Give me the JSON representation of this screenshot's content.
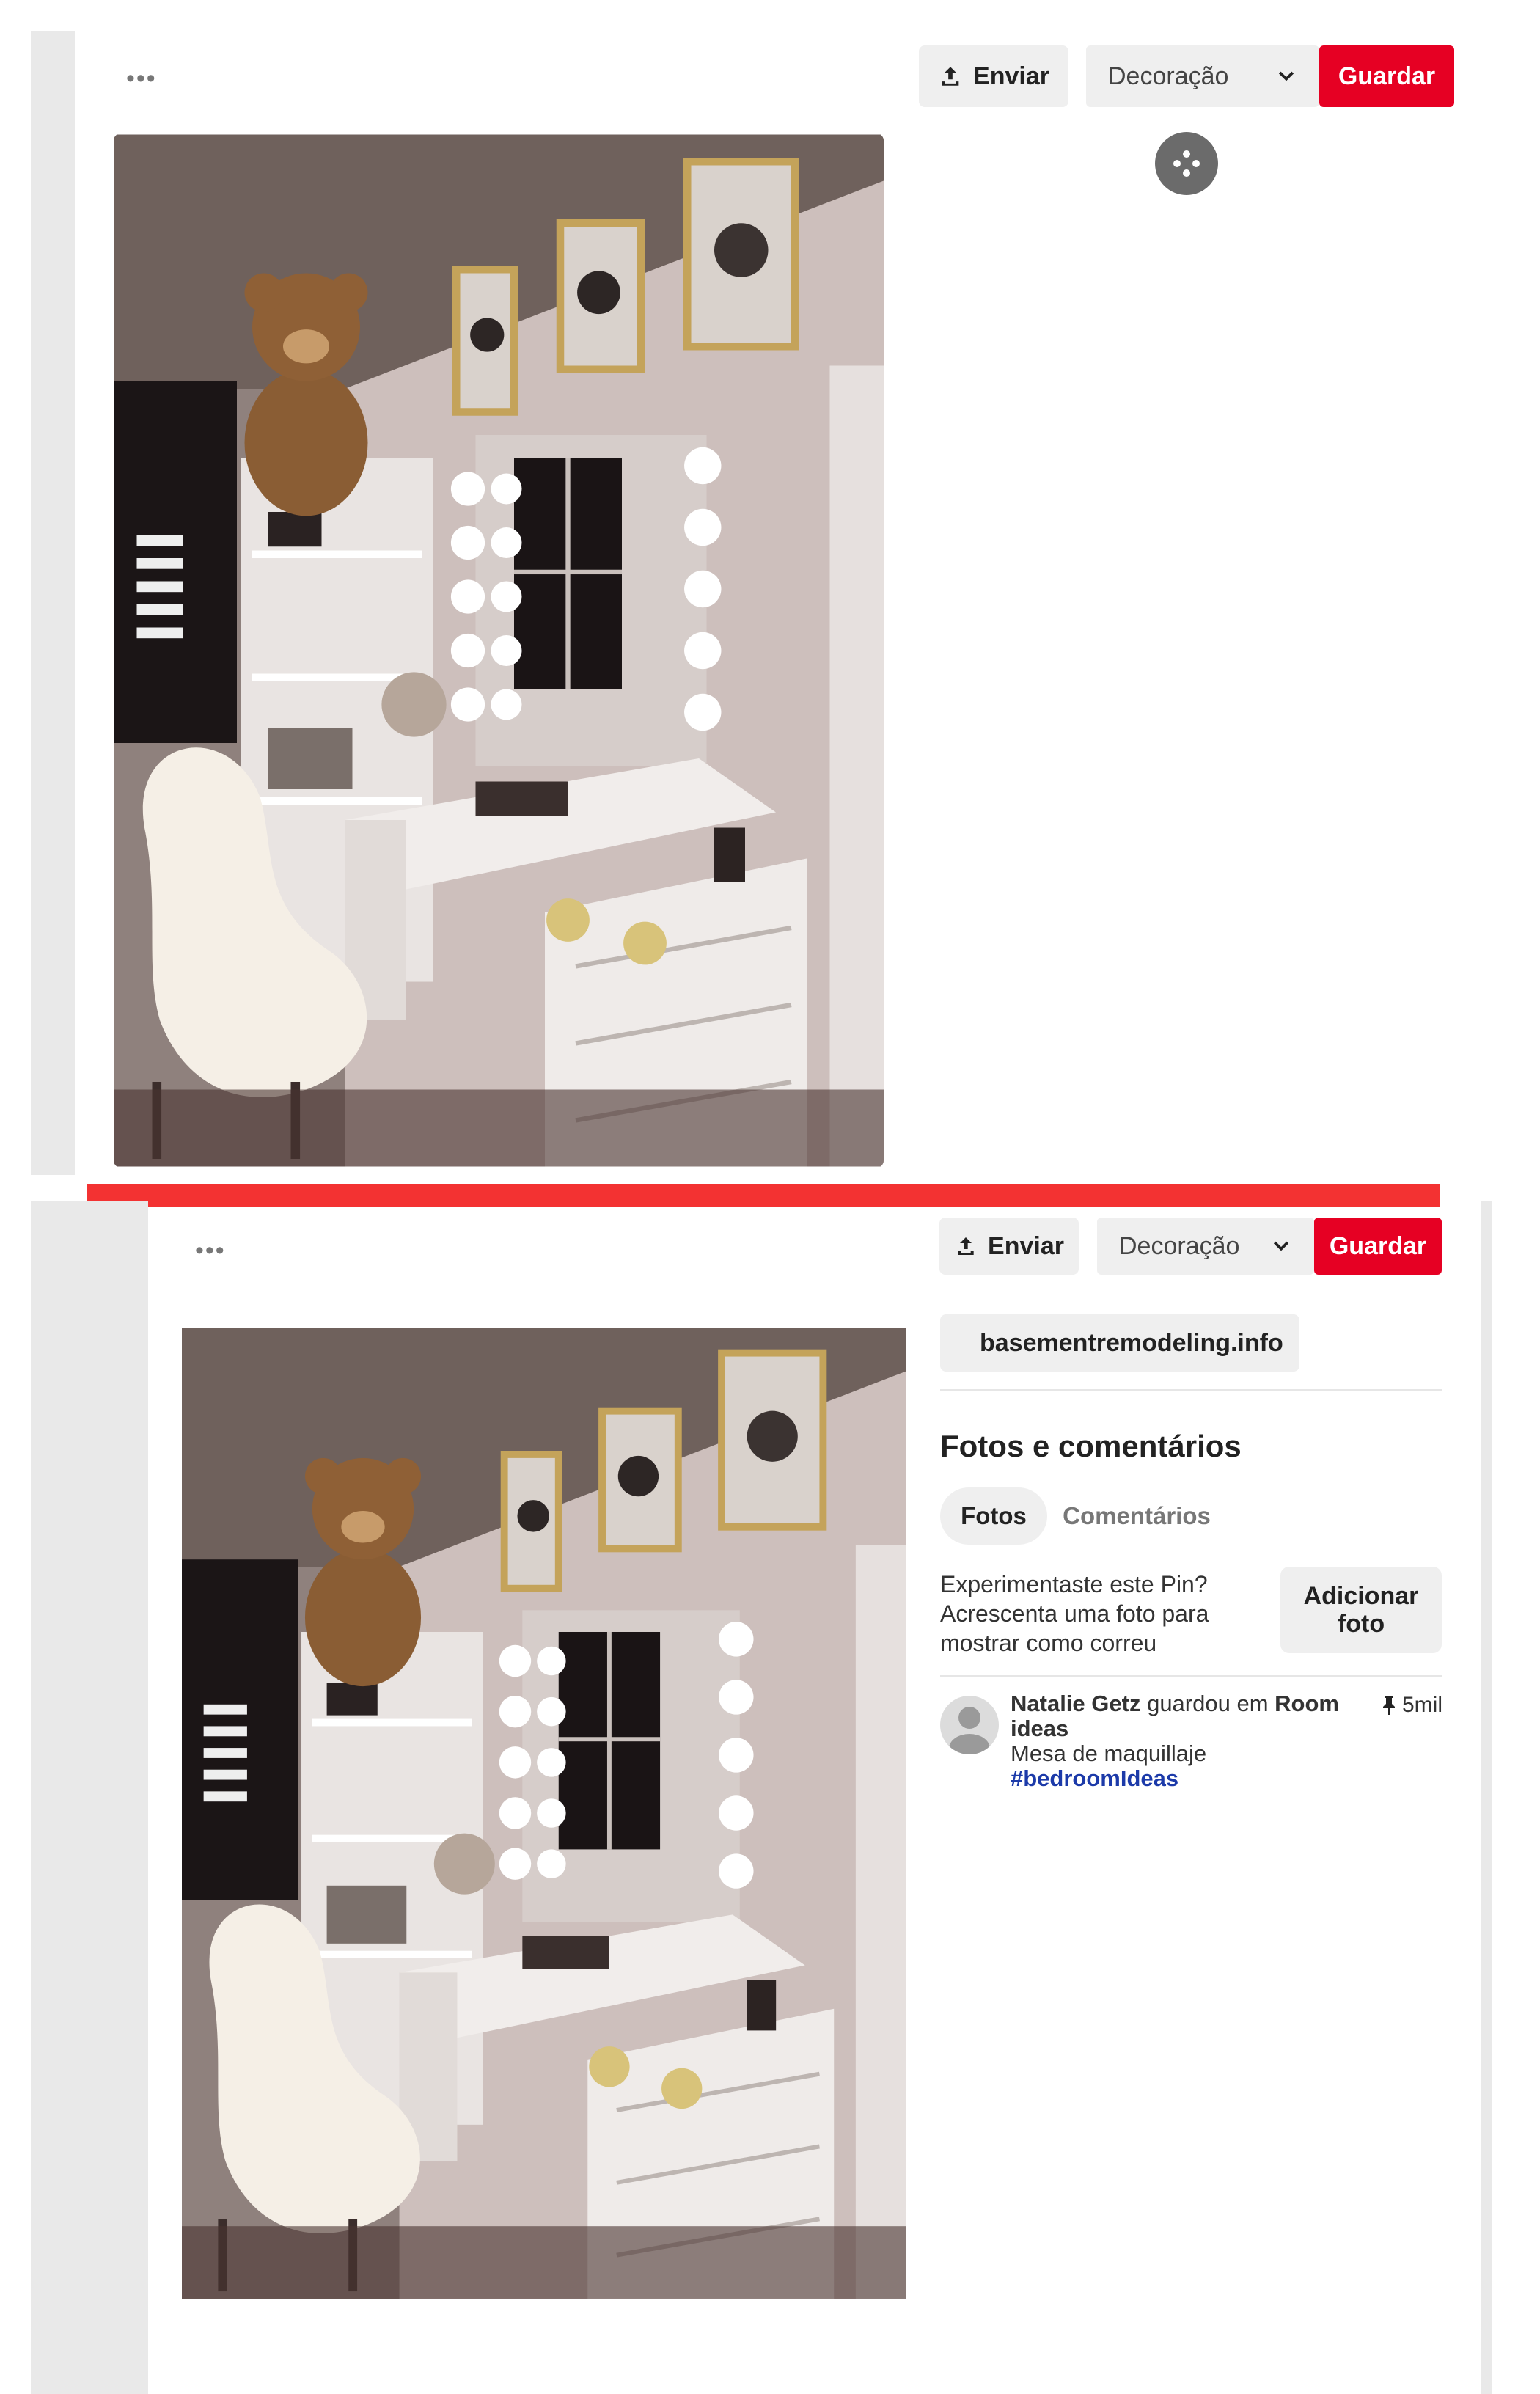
{
  "top": {
    "more_label": "•••",
    "enviar_label": "Enviar",
    "board_selected": "Decoração",
    "guardar_label": "Guardar"
  },
  "bottom": {
    "more_label": "•••",
    "enviar_label": "Enviar",
    "board_selected": "Decoração",
    "guardar_label": "Guardar",
    "source_link": "basementremodeling.info",
    "section_title": "Fotos e comentários",
    "tabs": [
      {
        "label": "Fotos",
        "active": true
      },
      {
        "label": "Comentários",
        "active": false
      }
    ],
    "try_prompt": "Experimentaste este Pin? Acrescenta uma foto para mostrar como correu",
    "add_photo_label": "Adicionar foto",
    "activity": {
      "user": "Natalie Getz",
      "action": "guardou em",
      "board": "Room ideas",
      "description": "Mesa de maquillaje",
      "hashtag": "#bedroomIdeas",
      "save_count": "5mil"
    }
  },
  "colors": {
    "accent_red": "#e60023",
    "divider_red": "#f33232",
    "hashtag_blue": "#1c3aa9"
  }
}
